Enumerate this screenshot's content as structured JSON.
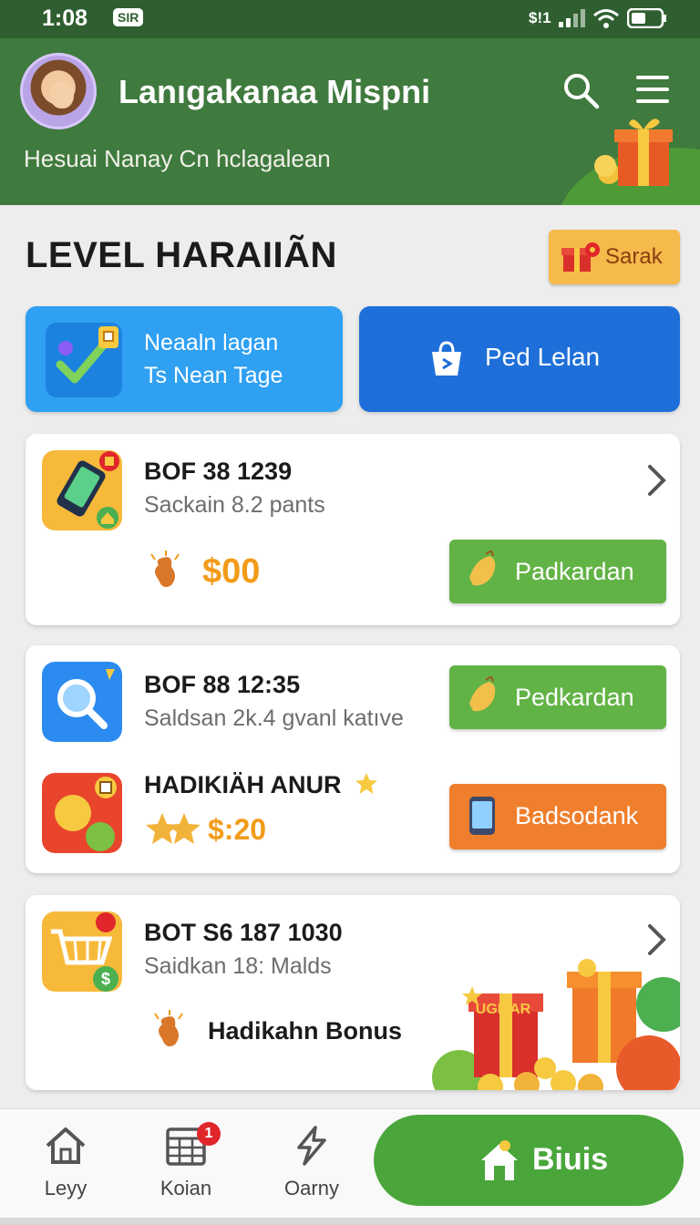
{
  "status_bar": {
    "time": "1:08",
    "sim_label": "SIR",
    "network": "$!1"
  },
  "header": {
    "title": "Lanıgakanaa Mispni",
    "subtitle": "Hesuai Nanay Cn hclagalean"
  },
  "section": {
    "title": "LEVEL HARAIIÃN",
    "sarak_label": "Sarak"
  },
  "tiles": [
    {
      "line1": "Neaaln lagan",
      "line2": "Ts Nean Tage"
    },
    {
      "line1": "Ped Lelan"
    }
  ],
  "cards": [
    {
      "title": "BOF 38 1239",
      "subtitle": "Sackain 8.2 pants",
      "amount": "$00",
      "button": "Padkardan"
    },
    {
      "title": "BOF 88 12:35",
      "subtitle": "Saldsan 2k.4 gvanl katıve",
      "button": "Pedkardan",
      "sub_title": "HADIKIÄH ANUR",
      "amount": "$:20",
      "button2": "Badsodank"
    },
    {
      "title": "BOT S6 187 1030",
      "subtitle": "Saidkan 18: Malds",
      "bonus": "Hadikahn Bonus",
      "gift_label": "UGMAR"
    }
  ],
  "bottom_nav": {
    "items": [
      {
        "label": "Leyy",
        "icon": "home-icon"
      },
      {
        "label": "Koian",
        "icon": "calendar-icon",
        "badge": "1"
      },
      {
        "label": "Oarny",
        "icon": "lightning-icon"
      }
    ],
    "primary_label": "Biuis"
  },
  "colors": {
    "header_green": "#3f7a3e",
    "action_green": "#62b346",
    "action_orange": "#ef7f2c",
    "tile_blue": "#2fa0f2",
    "tile_dark_blue": "#1e6fd9",
    "amount_orange": "#f29b18"
  }
}
